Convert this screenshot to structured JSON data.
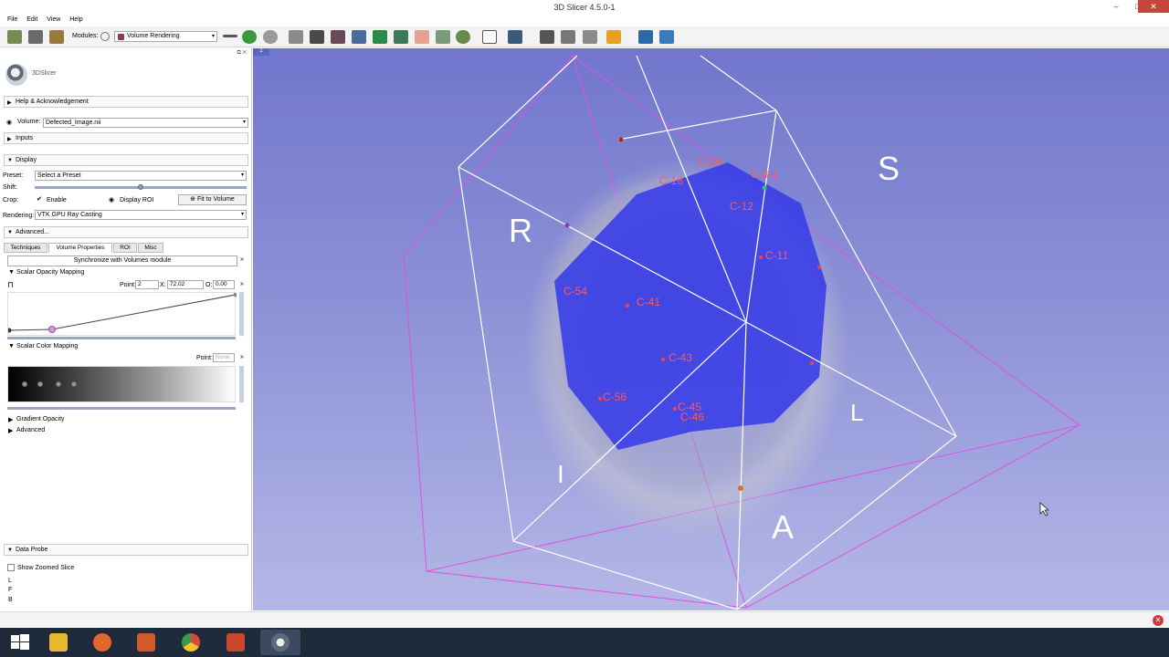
{
  "window": {
    "title": "3D Slicer 4.5.0-1",
    "minimize": "–",
    "maximize": "□",
    "close": "✕"
  },
  "menu": [
    "File",
    "Edit",
    "View",
    "Help"
  ],
  "toolbar": {
    "modules_label": "Modules:",
    "module_selected": "Volume Rendering"
  },
  "panel": {
    "logo_text": "3DSlicer",
    "help_section": "Help & Acknowledgement",
    "volume_label": "Volume:",
    "volume_value": "Defected_Image.nii",
    "inputs_section": "Inputs",
    "display_section": "Display",
    "preset_label": "Preset:",
    "preset_value": "Select a Preset",
    "shift_label": "Shift:",
    "crop_label": "Crop:",
    "enable_label": "Enable",
    "display_roi_label": "Display ROI",
    "fit_to_volume": "Fit to Volume",
    "rendering_label": "Rendering:",
    "rendering_value": "VTK GPU Ray Casting",
    "advanced_section": "Advanced...",
    "tabs": [
      "Techniques",
      "Volume Properties",
      "ROI",
      "Misc"
    ],
    "sync_button": "Synchronize with Volumes module",
    "scalar_opacity_section": "Scalar Opacity Mapping",
    "point_label": "Point:",
    "point_value": "2",
    "x_label": "X:",
    "x_value": "72.02",
    "o_label": "O:",
    "o_value": "0.00",
    "scalar_color_section": "Scalar Color Mapping",
    "color_point_label": "Point:",
    "color_point_value": "None",
    "gradient_section": "Gradient Opacity",
    "advanced2_section": "Advanced",
    "data_probe_section": "Data Probe",
    "show_zoomed_slice": "Show Zoomed Slice",
    "probe_lines": [
      "L",
      "F",
      "B"
    ]
  },
  "viewport": {
    "view_tab": "1",
    "orientation_labels": [
      "R",
      "S",
      "L",
      "I",
      "A"
    ],
    "fiducial_labels": [
      "C-14",
      "C-8-1",
      "C-18",
      "C-12",
      "C-11",
      "C-54",
      "C-41",
      "C-43",
      "C-56",
      "C-45",
      "C-46"
    ]
  },
  "colors": {
    "viewport_bg": "#7e83d2",
    "roi_box": "#ffffff",
    "outer_box": "#d850d8",
    "volume_blue": "#3a3ee6",
    "fiducial": "#ff4040"
  }
}
